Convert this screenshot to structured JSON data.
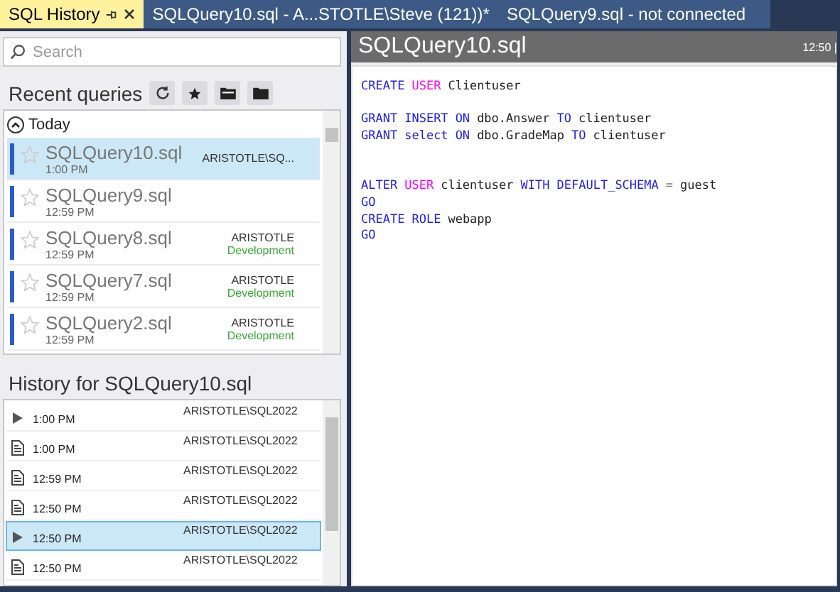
{
  "tabs": [
    {
      "label": "SQL History",
      "selected": true,
      "kind": "tool"
    },
    {
      "label": "SQLQuery10.sql - A...STOTLE\\Steve (121))*",
      "selected": false,
      "kind": "doc"
    },
    {
      "label": "SQLQuery9.sql - not connected",
      "selected": false,
      "kind": "doc"
    }
  ],
  "search": {
    "placeholder": "Search"
  },
  "recent": {
    "title": "Recent queries",
    "group": {
      "label": "Today",
      "expanded": true
    },
    "items": [
      {
        "name": "SQLQuery10.sql",
        "time": "1:00 PM",
        "server": "ARISTOTLE\\SQ...",
        "selected": true,
        "starred": false
      },
      {
        "name": "SQLQuery9.sql",
        "time": "12:59 PM",
        "selected": false,
        "starred": false
      },
      {
        "name": "SQLQuery8.sql",
        "time": "12:59 PM",
        "server": "ARISTOTLE",
        "env": "Development",
        "selected": false,
        "starred": false
      },
      {
        "name": "SQLQuery7.sql",
        "time": "12:59 PM",
        "server": "ARISTOTLE",
        "env": "Development",
        "selected": false,
        "starred": false
      },
      {
        "name": "SQLQuery2.sql",
        "time": "12:59 PM",
        "server": "ARISTOTLE",
        "env": "Development",
        "selected": false,
        "starred": false
      }
    ]
  },
  "history": {
    "title": "History for SQLQuery10.sql",
    "rows": [
      {
        "kind": "run",
        "time": "1:00 PM",
        "server": "ARISTOTLE\\SQL2022",
        "selected": false
      },
      {
        "kind": "script",
        "time": "1:00 PM",
        "server": "ARISTOTLE\\SQL2022",
        "selected": false
      },
      {
        "kind": "script",
        "time": "12:59 PM",
        "server": "ARISTOTLE\\SQL2022",
        "selected": false
      },
      {
        "kind": "script",
        "time": "12:50 PM",
        "server": "ARISTOTLE\\SQL2022",
        "selected": false
      },
      {
        "kind": "run",
        "time": "12:50 PM",
        "server": "ARISTOTLE\\SQL2022",
        "selected": true
      },
      {
        "kind": "script",
        "time": "12:50 PM",
        "server": "ARISTOTLE\\SQL2022",
        "selected": false
      }
    ]
  },
  "preview": {
    "title": "SQLQuery10.sql",
    "time": "12:50 |",
    "lines": [
      {
        "kind": "code",
        "tokens": [
          {
            "kind": "keyword",
            "text": "CREATE"
          },
          {
            "kind": "function",
            "text": "USER"
          },
          {
            "kind": "plain",
            "text": "Clientuser"
          }
        ]
      },
      {
        "kind": "blank"
      },
      {
        "kind": "code",
        "tokens": [
          {
            "kind": "keyword",
            "text": "GRANT"
          },
          {
            "kind": "keyword",
            "text": "INSERT"
          },
          {
            "kind": "keyword",
            "text": "ON"
          },
          {
            "kind": "plain",
            "text": "dbo.Answer"
          },
          {
            "kind": "keyword",
            "text": "TO"
          },
          {
            "kind": "plain",
            "text": "clientuser"
          }
        ]
      },
      {
        "kind": "code",
        "tokens": [
          {
            "kind": "keyword",
            "text": "GRANT"
          },
          {
            "kind": "keyword",
            "text": "select"
          },
          {
            "kind": "keyword",
            "text": "ON"
          },
          {
            "kind": "plain",
            "text": "dbo.GradeMap"
          },
          {
            "kind": "keyword",
            "text": "TO"
          },
          {
            "kind": "plain",
            "text": "clientuser"
          }
        ]
      },
      {
        "kind": "blank"
      },
      {
        "kind": "blank"
      },
      {
        "kind": "code",
        "tokens": [
          {
            "kind": "keyword",
            "text": "ALTER"
          },
          {
            "kind": "function",
            "text": "USER"
          },
          {
            "kind": "plain",
            "text": "clientuser"
          },
          {
            "kind": "keyword",
            "text": "WITH"
          },
          {
            "kind": "keyword",
            "text": "DEFAULT_SCHEMA"
          },
          {
            "kind": "operator",
            "text": "="
          },
          {
            "kind": "plain",
            "text": "guest"
          }
        ]
      },
      {
        "kind": "code",
        "tokens": [
          {
            "kind": "keyword",
            "text": "GO"
          }
        ]
      },
      {
        "kind": "code",
        "tokens": [
          {
            "kind": "keyword",
            "text": "CREATE"
          },
          {
            "kind": "keyword",
            "text": "ROLE"
          },
          {
            "kind": "plain",
            "text": "webapp"
          }
        ]
      },
      {
        "kind": "code",
        "tokens": [
          {
            "kind": "keyword",
            "text": "GO"
          }
        ]
      }
    ]
  }
}
